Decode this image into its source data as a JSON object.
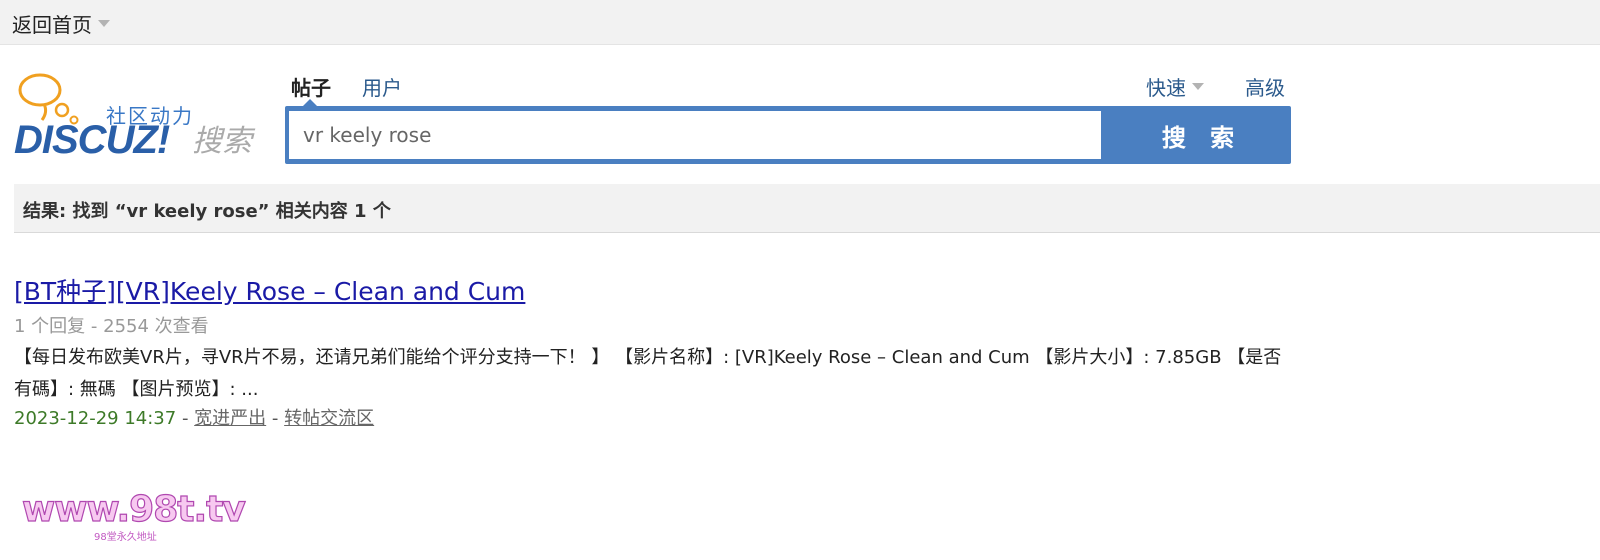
{
  "topbar": {
    "back_home": "返回首页"
  },
  "logo": {
    "community": "社区动力",
    "brand": "DISCUZ!",
    "search": "搜索"
  },
  "tabs": {
    "posts": "帖子",
    "users": "用户"
  },
  "options": {
    "quick": "快速",
    "advanced": "高级"
  },
  "search": {
    "value": "vr keely rose",
    "button": "搜 索"
  },
  "result_summary": "结果: 找到 “vr keely rose” 相关内容 1 个",
  "results": [
    {
      "title": "[BT种子][VR]Keely Rose – Clean and Cum",
      "meta": "1 个回复 - 2554 次查看",
      "snippet": "【每日发布欧美VR片，寻VR片不易，还请兄弟们能给个评分支持一下！ 】 【影片名称】: [VR]Keely Rose – Clean and Cum 【影片大小】: 7.85GB 【是否有碼】: 無碼 【图片预览】: ...",
      "date": "2023-12-29 14:37",
      "separator": "-",
      "author": "宽进严出",
      "forum": "转帖交流区"
    }
  ],
  "watermark": {
    "site": "www.98t.tv",
    "tagline": "98堂永久地址"
  },
  "colors": {
    "accent": "#4a7fc1",
    "link": "#1a1aa6",
    "date": "#3d7a28"
  }
}
